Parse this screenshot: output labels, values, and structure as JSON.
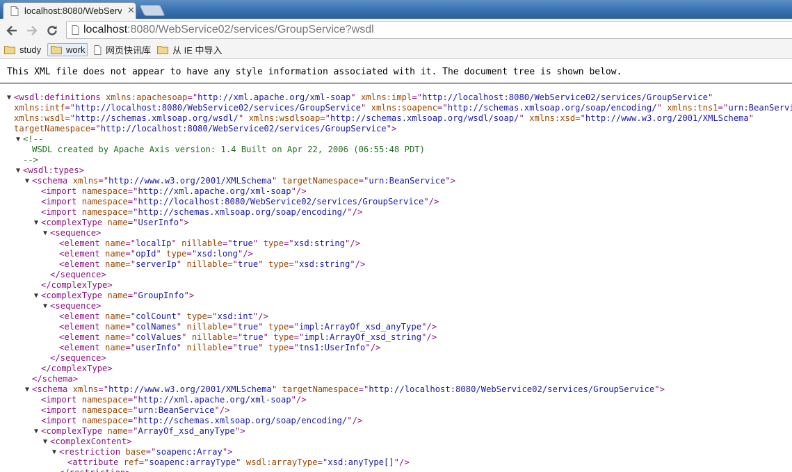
{
  "browser": {
    "tab_title": "localhost:8080/WebServ",
    "url_host": "localhost",
    "url_rest": ":8080/WebService02/services/GroupService?wsdl",
    "bookmarks": [
      "study",
      "work",
      "网页快讯库",
      "从 IE 中导入"
    ]
  },
  "page": {
    "notice": "This XML file does not appear to have any style information associated with it. The document tree is shown below."
  },
  "colors": {
    "tag": "#881280",
    "attr_name": "#994500",
    "attr_value": "#1a1aa6",
    "comment": "#236e25"
  },
  "tree_lines": [
    [
      [
        "t",
        "<wsdl:definitions "
      ],
      [
        "n",
        "xmlns:apachesoap"
      ],
      [
        "t",
        "=\""
      ],
      [
        "v",
        "http://xml.apache.org/xml-soap"
      ],
      [
        "t",
        "\" "
      ],
      [
        "n",
        "xmlns:impl"
      ],
      [
        "t",
        "=\""
      ],
      [
        "v",
        "http://localhost:8080/WebService02/services/GroupService"
      ],
      [
        "t",
        "\""
      ]
    ],
    [
      [
        "n",
        "xmlns:intf"
      ],
      [
        "t",
        "=\""
      ],
      [
        "v",
        "http://localhost:8080/WebService02/services/GroupService"
      ],
      [
        "t",
        "\" "
      ],
      [
        "n",
        "xmlns:soapenc"
      ],
      [
        "t",
        "=\""
      ],
      [
        "v",
        "http://schemas.xmlsoap.org/soap/encoding/"
      ],
      [
        "t",
        "\" "
      ],
      [
        "n",
        "xmlns:tns1"
      ],
      [
        "t",
        "=\""
      ],
      [
        "v",
        "urn:BeanService"
      ],
      [
        "t",
        "\""
      ]
    ],
    [
      [
        "n",
        "xmlns:wsdl"
      ],
      [
        "t",
        "=\""
      ],
      [
        "v",
        "http://schemas.xmlsoap.org/wsdl/"
      ],
      [
        "t",
        "\" "
      ],
      [
        "n",
        "xmlns:wsdlsoap"
      ],
      [
        "t",
        "=\""
      ],
      [
        "v",
        "http://schemas.xmlsoap.org/wsdl/soap/"
      ],
      [
        "t",
        "\" "
      ],
      [
        "n",
        "xmlns:xsd"
      ],
      [
        "t",
        "=\""
      ],
      [
        "v",
        "http://www.w3.org/2001/XMLSchema"
      ],
      [
        "t",
        "\""
      ]
    ],
    [
      [
        "n",
        "targetNamespace"
      ],
      [
        "t",
        "=\""
      ],
      [
        "v",
        "http://localhost:8080/WebService02/services/GroupService"
      ],
      [
        "t",
        "\">"
      ]
    ],
    [
      [
        "c",
        "<!--"
      ]
    ],
    [
      [
        "c",
        "WSDL created by Apache Axis version: 1.4 Built on Apr 22, 2006 (06:55:48 PDT)"
      ]
    ],
    [
      [
        "c",
        "-->"
      ]
    ],
    [
      [
        "t",
        "<wsdl:types>"
      ]
    ],
    [
      [
        "t",
        "<schema "
      ],
      [
        "n",
        "xmlns"
      ],
      [
        "t",
        "=\""
      ],
      [
        "v",
        "http://www.w3.org/2001/XMLSchema"
      ],
      [
        "t",
        "\" "
      ],
      [
        "n",
        "targetNamespace"
      ],
      [
        "t",
        "=\""
      ],
      [
        "v",
        "urn:BeanService"
      ],
      [
        "t",
        "\">"
      ]
    ],
    [
      [
        "t",
        "<import "
      ],
      [
        "n",
        "namespace"
      ],
      [
        "t",
        "=\""
      ],
      [
        "v",
        "http://xml.apache.org/xml-soap"
      ],
      [
        "t",
        "\"/>"
      ]
    ],
    [
      [
        "t",
        "<import "
      ],
      [
        "n",
        "namespace"
      ],
      [
        "t",
        "=\""
      ],
      [
        "v",
        "http://localhost:8080/WebService02/services/GroupService"
      ],
      [
        "t",
        "\"/>"
      ]
    ],
    [
      [
        "t",
        "<import "
      ],
      [
        "n",
        "namespace"
      ],
      [
        "t",
        "=\""
      ],
      [
        "v",
        "http://schemas.xmlsoap.org/soap/encoding/"
      ],
      [
        "t",
        "\"/>"
      ]
    ],
    [
      [
        "t",
        "<complexType "
      ],
      [
        "n",
        "name"
      ],
      [
        "t",
        "=\""
      ],
      [
        "v",
        "UserInfo"
      ],
      [
        "t",
        "\">"
      ]
    ],
    [
      [
        "t",
        "<sequence>"
      ]
    ],
    [
      [
        "t",
        "<element "
      ],
      [
        "n",
        "name"
      ],
      [
        "t",
        "=\""
      ],
      [
        "v",
        "localIp"
      ],
      [
        "t",
        "\" "
      ],
      [
        "n",
        "nillable"
      ],
      [
        "t",
        "=\""
      ],
      [
        "v",
        "true"
      ],
      [
        "t",
        "\" "
      ],
      [
        "n",
        "type"
      ],
      [
        "t",
        "=\""
      ],
      [
        "v",
        "xsd:string"
      ],
      [
        "t",
        "\"/>"
      ]
    ],
    [
      [
        "t",
        "<element "
      ],
      [
        "n",
        "name"
      ],
      [
        "t",
        "=\""
      ],
      [
        "v",
        "opId"
      ],
      [
        "t",
        "\" "
      ],
      [
        "n",
        "type"
      ],
      [
        "t",
        "=\""
      ],
      [
        "v",
        "xsd:long"
      ],
      [
        "t",
        "\"/>"
      ]
    ],
    [
      [
        "t",
        "<element "
      ],
      [
        "n",
        "name"
      ],
      [
        "t",
        "=\""
      ],
      [
        "v",
        "serverIp"
      ],
      [
        "t",
        "\" "
      ],
      [
        "n",
        "nillable"
      ],
      [
        "t",
        "=\""
      ],
      [
        "v",
        "true"
      ],
      [
        "t",
        "\" "
      ],
      [
        "n",
        "type"
      ],
      [
        "t",
        "=\""
      ],
      [
        "v",
        "xsd:string"
      ],
      [
        "t",
        "\"/>"
      ]
    ],
    [
      [
        "t",
        "</sequence>"
      ]
    ],
    [
      [
        "t",
        "</complexType>"
      ]
    ],
    [
      [
        "t",
        "<complexType "
      ],
      [
        "n",
        "name"
      ],
      [
        "t",
        "=\""
      ],
      [
        "v",
        "GroupInfo"
      ],
      [
        "t",
        "\">"
      ]
    ],
    [
      [
        "t",
        "<sequence>"
      ]
    ],
    [
      [
        "t",
        "<element "
      ],
      [
        "n",
        "name"
      ],
      [
        "t",
        "=\""
      ],
      [
        "v",
        "colCount"
      ],
      [
        "t",
        "\" "
      ],
      [
        "n",
        "type"
      ],
      [
        "t",
        "=\""
      ],
      [
        "v",
        "xsd:int"
      ],
      [
        "t",
        "\"/>"
      ]
    ],
    [
      [
        "t",
        "<element "
      ],
      [
        "n",
        "name"
      ],
      [
        "t",
        "=\""
      ],
      [
        "v",
        "colNames"
      ],
      [
        "t",
        "\" "
      ],
      [
        "n",
        "nillable"
      ],
      [
        "t",
        "=\""
      ],
      [
        "v",
        "true"
      ],
      [
        "t",
        "\" "
      ],
      [
        "n",
        "type"
      ],
      [
        "t",
        "=\""
      ],
      [
        "v",
        "impl:ArrayOf_xsd_anyType"
      ],
      [
        "t",
        "\"/>"
      ]
    ],
    [
      [
        "t",
        "<element "
      ],
      [
        "n",
        "name"
      ],
      [
        "t",
        "=\""
      ],
      [
        "v",
        "colValues"
      ],
      [
        "t",
        "\" "
      ],
      [
        "n",
        "nillable"
      ],
      [
        "t",
        "=\""
      ],
      [
        "v",
        "true"
      ],
      [
        "t",
        "\" "
      ],
      [
        "n",
        "type"
      ],
      [
        "t",
        "=\""
      ],
      [
        "v",
        "impl:ArrayOf_xsd_string"
      ],
      [
        "t",
        "\"/>"
      ]
    ],
    [
      [
        "t",
        "<element "
      ],
      [
        "n",
        "name"
      ],
      [
        "t",
        "=\""
      ],
      [
        "v",
        "userInfo"
      ],
      [
        "t",
        "\" "
      ],
      [
        "n",
        "nillable"
      ],
      [
        "t",
        "=\""
      ],
      [
        "v",
        "true"
      ],
      [
        "t",
        "\" "
      ],
      [
        "n",
        "type"
      ],
      [
        "t",
        "=\""
      ],
      [
        "v",
        "tns1:UserInfo"
      ],
      [
        "t",
        "\"/>"
      ]
    ],
    [
      [
        "t",
        "</sequence>"
      ]
    ],
    [
      [
        "t",
        "</complexType>"
      ]
    ],
    [
      [
        "t",
        "</schema>"
      ]
    ],
    [
      [
        "t",
        "<schema "
      ],
      [
        "n",
        "xmlns"
      ],
      [
        "t",
        "=\""
      ],
      [
        "v",
        "http://www.w3.org/2001/XMLSchema"
      ],
      [
        "t",
        "\" "
      ],
      [
        "n",
        "targetNamespace"
      ],
      [
        "t",
        "=\""
      ],
      [
        "v",
        "http://localhost:8080/WebService02/services/GroupService"
      ],
      [
        "t",
        "\">"
      ]
    ],
    [
      [
        "t",
        "<import "
      ],
      [
        "n",
        "namespace"
      ],
      [
        "t",
        "=\""
      ],
      [
        "v",
        "http://xml.apache.org/xml-soap"
      ],
      [
        "t",
        "\"/>"
      ]
    ],
    [
      [
        "t",
        "<import "
      ],
      [
        "n",
        "namespace"
      ],
      [
        "t",
        "=\""
      ],
      [
        "v",
        "urn:BeanService"
      ],
      [
        "t",
        "\"/>"
      ]
    ],
    [
      [
        "t",
        "<import "
      ],
      [
        "n",
        "namespace"
      ],
      [
        "t",
        "=\""
      ],
      [
        "v",
        "http://schemas.xmlsoap.org/soap/encoding/"
      ],
      [
        "t",
        "\"/>"
      ]
    ],
    [
      [
        "t",
        "<complexType "
      ],
      [
        "n",
        "name"
      ],
      [
        "t",
        "=\""
      ],
      [
        "v",
        "ArrayOf_xsd_anyType"
      ],
      [
        "t",
        "\">"
      ]
    ],
    [
      [
        "t",
        "<complexContent>"
      ]
    ],
    [
      [
        "t",
        "<restriction "
      ],
      [
        "n",
        "base"
      ],
      [
        "t",
        "=\""
      ],
      [
        "v",
        "soapenc:Array"
      ],
      [
        "t",
        "\">"
      ]
    ],
    [
      [
        "t",
        "<attribute "
      ],
      [
        "n",
        "ref"
      ],
      [
        "t",
        "=\""
      ],
      [
        "v",
        "soapenc:arrayType"
      ],
      [
        "t",
        "\" "
      ],
      [
        "n",
        "wsdl:arrayType"
      ],
      [
        "t",
        "=\""
      ],
      [
        "v",
        "xsd:anyType[]"
      ],
      [
        "t",
        "\"/>"
      ]
    ],
    [
      [
        "t",
        "</restriction>"
      ]
    ]
  ]
}
